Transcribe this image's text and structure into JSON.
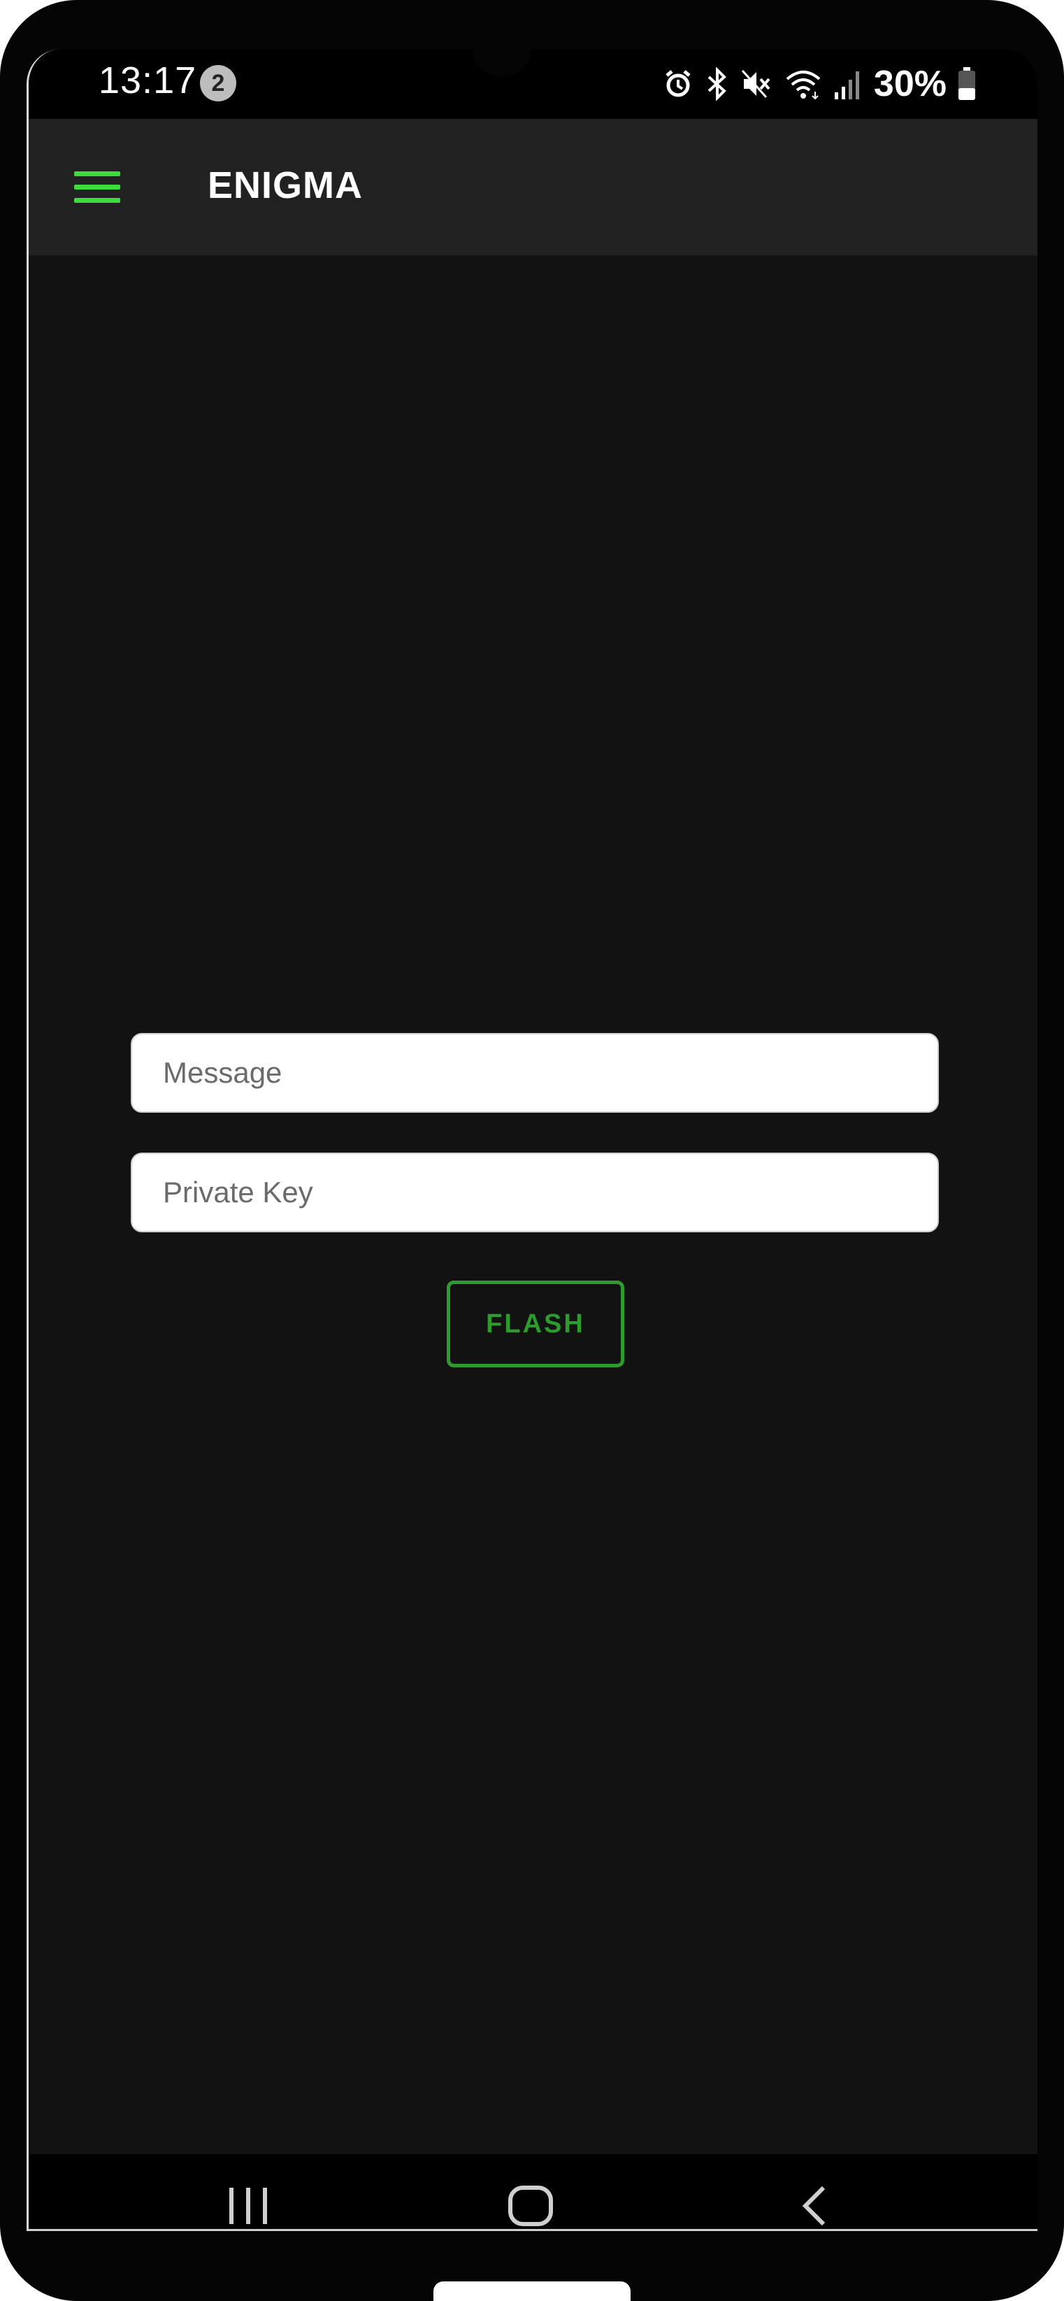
{
  "status_bar": {
    "time": "13:17",
    "notification_count": "2",
    "battery_percent": "30%",
    "icons": [
      "alarm-icon",
      "bluetooth-icon",
      "mute-icon",
      "wifi-icon",
      "signal-icon",
      "battery-icon"
    ]
  },
  "app_bar": {
    "title": "ENIGMA",
    "menu_icon": "hamburger-menu-icon",
    "accent_color": "#3ddc3d"
  },
  "form": {
    "message_placeholder": "Message",
    "message_value": "",
    "private_key_placeholder": "Private Key",
    "private_key_value": "",
    "flash_label": "FLASH",
    "button_color": "#2e9b2e"
  },
  "nav_bar": {
    "icons": [
      "recent-apps-icon",
      "home-icon",
      "back-icon"
    ]
  }
}
